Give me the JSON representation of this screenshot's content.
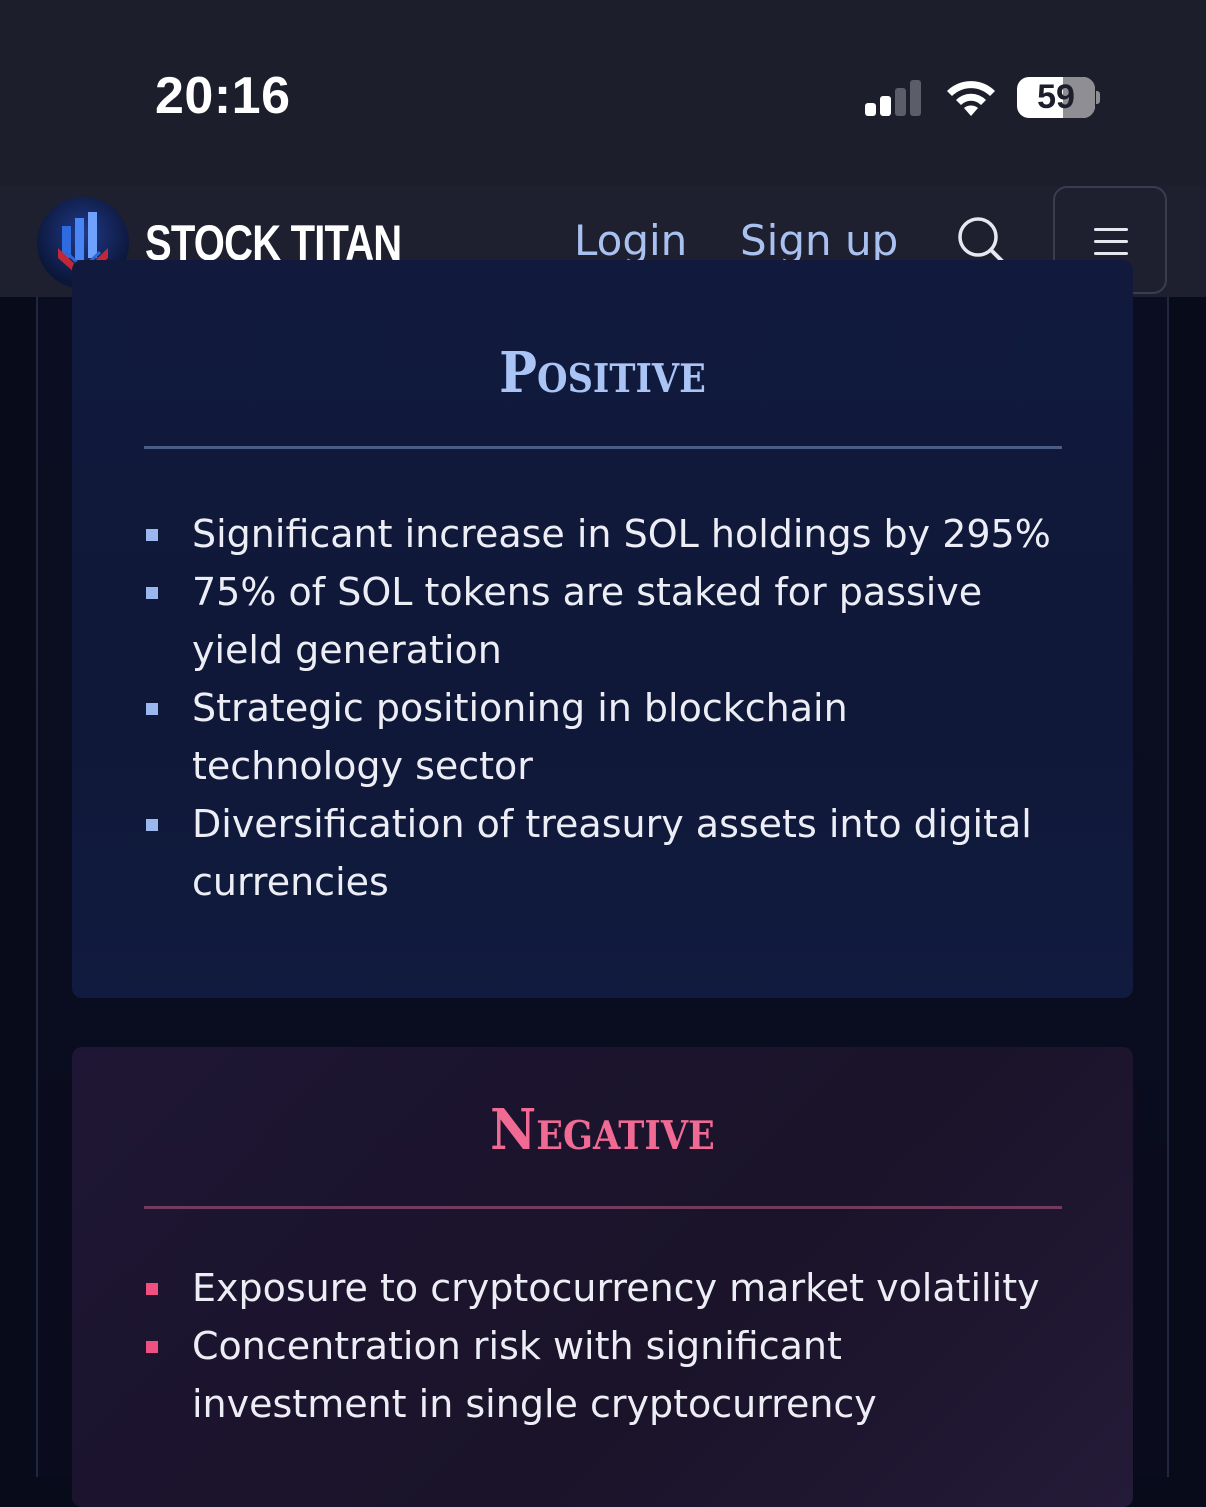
{
  "status_bar": {
    "time": "20:16",
    "battery_level": "59",
    "signal_bars_active": 2,
    "signal_bars_total": 4
  },
  "nav": {
    "brand": "STOCK TITAN",
    "login_label": "Login",
    "signup_label": "Sign up",
    "search_icon": "search-icon",
    "menu_icon": "hamburger-menu-icon"
  },
  "positive": {
    "title": "Positive",
    "accent_color": "#a9c4f5",
    "items": [
      "Significant increase in SOL holdings by 295%",
      "75% of SOL tokens are staked for passive yield generation",
      "Strategic positioning in blockchain technology sector",
      "Diversification of treasury assets into digital currencies"
    ]
  },
  "negative": {
    "title": "Negative",
    "accent_color": "#f06a93",
    "items": [
      "Exposure to cryptocurrency market volatility",
      "Concentration risk with significant investment in single cryptocurrency"
    ]
  }
}
